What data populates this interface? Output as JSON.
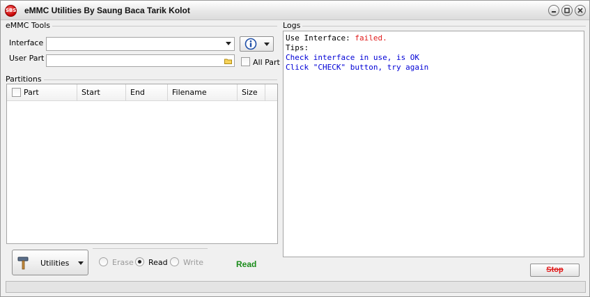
{
  "window": {
    "title": "eMMC Utilities  By Saung Baca Tarik Kolot",
    "logo_text": "SBS"
  },
  "emmc_tools": {
    "group_label": "eMMC Tools",
    "interface_label": "Interface",
    "interface_value": "",
    "user_part_label": "User Part",
    "user_part_value": "",
    "all_part_label": "All Part",
    "all_part_checked": false
  },
  "partitions": {
    "group_label": "Partitions",
    "columns": [
      "Part",
      "Start",
      "End",
      "Filename",
      "Size"
    ],
    "rows": []
  },
  "actions": {
    "utilities_label": "Utilities",
    "radio_options": [
      {
        "label": "Erase",
        "checked": false,
        "enabled": false
      },
      {
        "label": "Read",
        "checked": true,
        "enabled": true
      },
      {
        "label": "Write",
        "checked": false,
        "enabled": false
      }
    ],
    "status_text": "Read"
  },
  "logs": {
    "group_label": "Logs",
    "lines": [
      {
        "prefix": "Use Interface: ",
        "value": "failed."
      },
      {
        "text": "Tips:"
      },
      {
        "text": "Check interface in use, is OK"
      },
      {
        "text": "Click \"CHECK\" button, try again"
      }
    ],
    "stop_label": "Stop"
  },
  "colors": {
    "error": "#e01b1b",
    "tip": "#0000d6",
    "status_ok": "#1a8c1a"
  }
}
